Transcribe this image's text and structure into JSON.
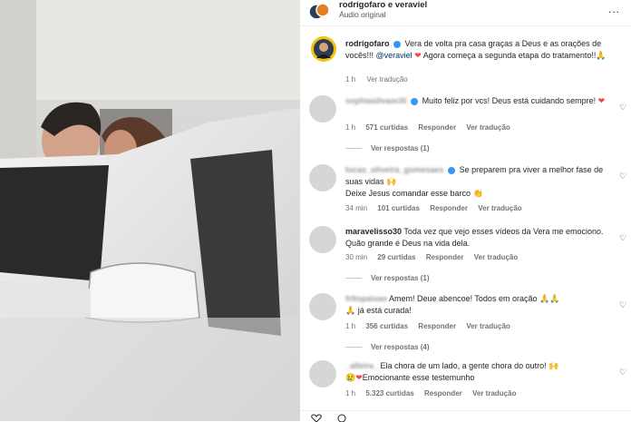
{
  "header": {
    "names": "rodrigofaro e veraviel",
    "subtitle": "Áudio original",
    "more": "..."
  },
  "caption": {
    "username": "rodrigofaro",
    "text_before_mention": "Vera de volta pra casa graças a Deus e as orações de vocês!!! ",
    "mention": "@veraviel",
    "text_after_mention": " Agora começa a segunda etapa do tratamento!!",
    "time": "1 h",
    "translate": "Ver tradução"
  },
  "comments": [
    {
      "username": "sophiasilvaoclit",
      "text": "Muito feliz por vcs! Deus está cuidando sempre! ",
      "emoji": "❤",
      "time": "1 h",
      "likes": "571 curtidas",
      "reply": "Responder",
      "translate": "Ver tradução",
      "replies": "Ver respostas (1)"
    },
    {
      "username": "lucas_oliveira_gomesaes",
      "text": "Se preparem pra viver a melhor fase de suas vidas ",
      "emoji": "🙌",
      "text2": "Deixe Jesus comandar esse barco ",
      "emoji2": "👏",
      "time": "34 min",
      "likes": "101 curtidas",
      "reply": "Responder",
      "translate": "Ver tradução"
    },
    {
      "username": "maravelisso30",
      "text": "Toda vez que vejo esses vídeos da Vera me emociono. Quão grande é Deus na vida dela.",
      "time": "30 min",
      "likes": "29 curtidas",
      "reply": "Responder",
      "translate": "Ver tradução",
      "replies": "Ver respostas (1)"
    },
    {
      "username": "fritopaisao",
      "text": "Amem! Deue abencoe! Todos em oração ",
      "emoji": "🙏🙏",
      "text2": " já está curada!",
      "emoji2": "🙏",
      "time": "1 h",
      "likes": "356 curtidas",
      "reply": "Responder",
      "translate": "Ver tradução",
      "replies": "Ver respostas (4)"
    },
    {
      "username": "_alleira_",
      "text": "Ela chora de um lado, a gente chora do outro! ",
      "emoji": "🙌",
      "text2": "Emocionante esse testemunho",
      "emoji2": "😢❤",
      "time": "1 h",
      "likes": "5.323 curtidas",
      "reply": "Responder",
      "translate": "Ver tradução"
    }
  ],
  "colors": {
    "verified": "#3897f0",
    "meta": "#737373",
    "text": "#262626"
  }
}
